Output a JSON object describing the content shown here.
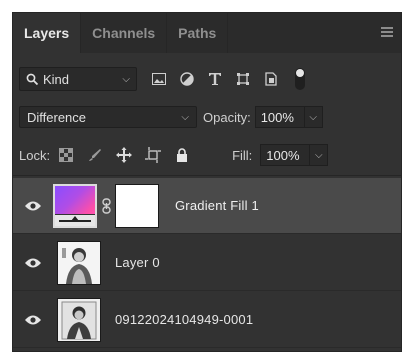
{
  "tabs": [
    {
      "label": "Layers",
      "active": true
    },
    {
      "label": "Channels",
      "active": false
    },
    {
      "label": "Paths",
      "active": false
    }
  ],
  "filter": {
    "kind_label": "Kind",
    "icons": [
      "search-icon",
      "image-filter-icon",
      "adjustment-filter-icon",
      "type-filter-icon",
      "shape-filter-icon",
      "smart-object-filter-icon"
    ]
  },
  "blend": {
    "mode": "Difference",
    "opacity_label": "Opacity:",
    "opacity_value": "100%"
  },
  "lock": {
    "label": "Lock:",
    "fill_label": "Fill:",
    "fill_value": "100%"
  },
  "layers": [
    {
      "name": "Gradient Fill 1",
      "selected": true,
      "visible": true
    },
    {
      "name": "Layer 0",
      "selected": false,
      "visible": true
    },
    {
      "name": "09122024104949-0001",
      "selected": false,
      "visible": true
    }
  ],
  "colors": {
    "panel_bg": "#323232",
    "selected_row": "#4a4a4a",
    "gradient_start": "#8a4dff",
    "gradient_end": "#ff63c8"
  }
}
